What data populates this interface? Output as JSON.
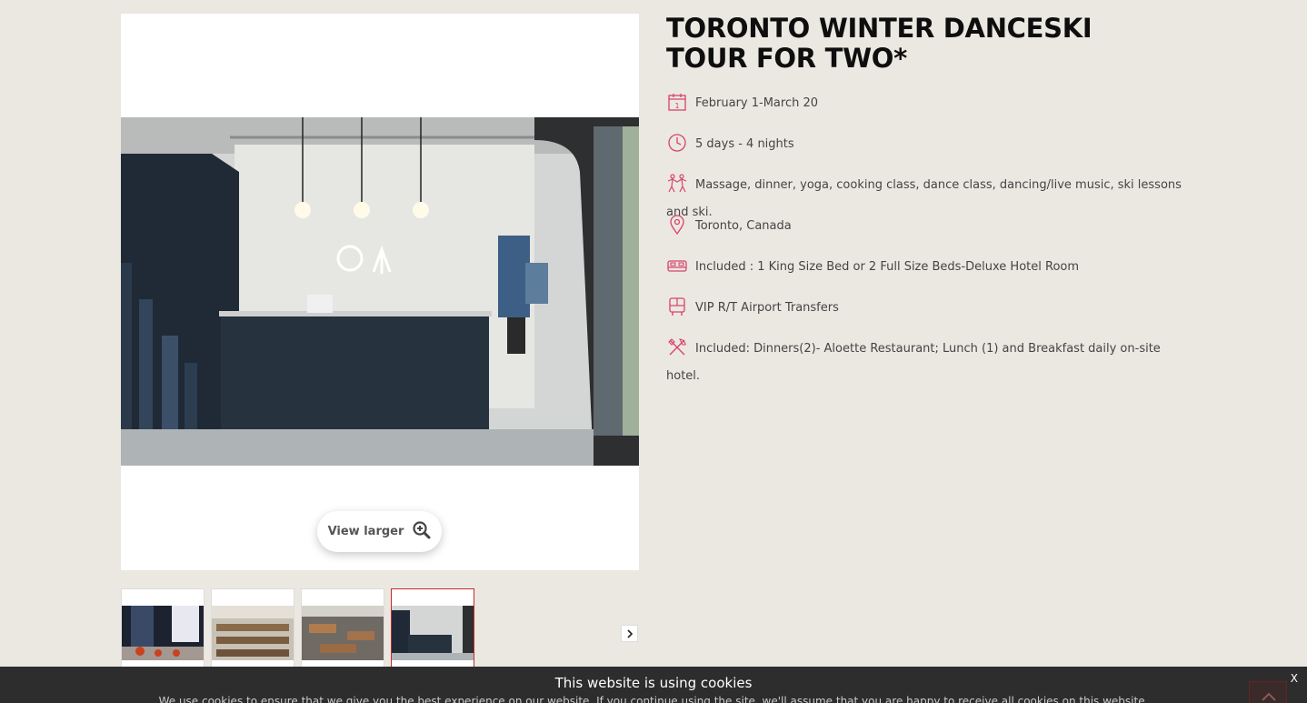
{
  "tour": {
    "title": "TORONTO WINTER DANCESKI TOUR FOR TWO*",
    "features": [
      {
        "icon": "calendar-icon",
        "text": "February 1-March 20"
      },
      {
        "icon": "clock-icon",
        "text": "5 days - 4 nights"
      },
      {
        "icon": "dancers-icon",
        "text": "Massage, dinner, yoga, cooking class, dance class, dancing/live music, ski lessons and ski."
      },
      {
        "icon": "location-pin-icon",
        "text": "Toronto, Canada"
      },
      {
        "icon": "bed-icon",
        "text": "Included : 1 King Size Bed or 2 Full Size Beds-Deluxe Hotel Room"
      },
      {
        "icon": "bus-icon",
        "text": "VIP R/T Airport Transfers"
      },
      {
        "icon": "fork-knife-icon",
        "text": "Included: Dinners(2)- Aloette Restaurant; Lunch (1) and Breakfast daily on-site hotel."
      }
    ]
  },
  "gallery": {
    "view_larger_label": "View larger",
    "active_thumb_index": 3,
    "thumbs": [
      "city-street-thumb",
      "restaurant-thumb",
      "yoga-room-thumb",
      "reception-thumb"
    ]
  },
  "cookies": {
    "title": "This website is using cookies",
    "text": "We use cookies to ensure that we give you the best experience on our website. If you continue using the site, we'll assume that you are happy to receive all cookies on this website.",
    "close_label": "X"
  },
  "colors": {
    "accent": "#d8436b",
    "active_border": "#c42b2b",
    "background": "#ebe8e1"
  }
}
